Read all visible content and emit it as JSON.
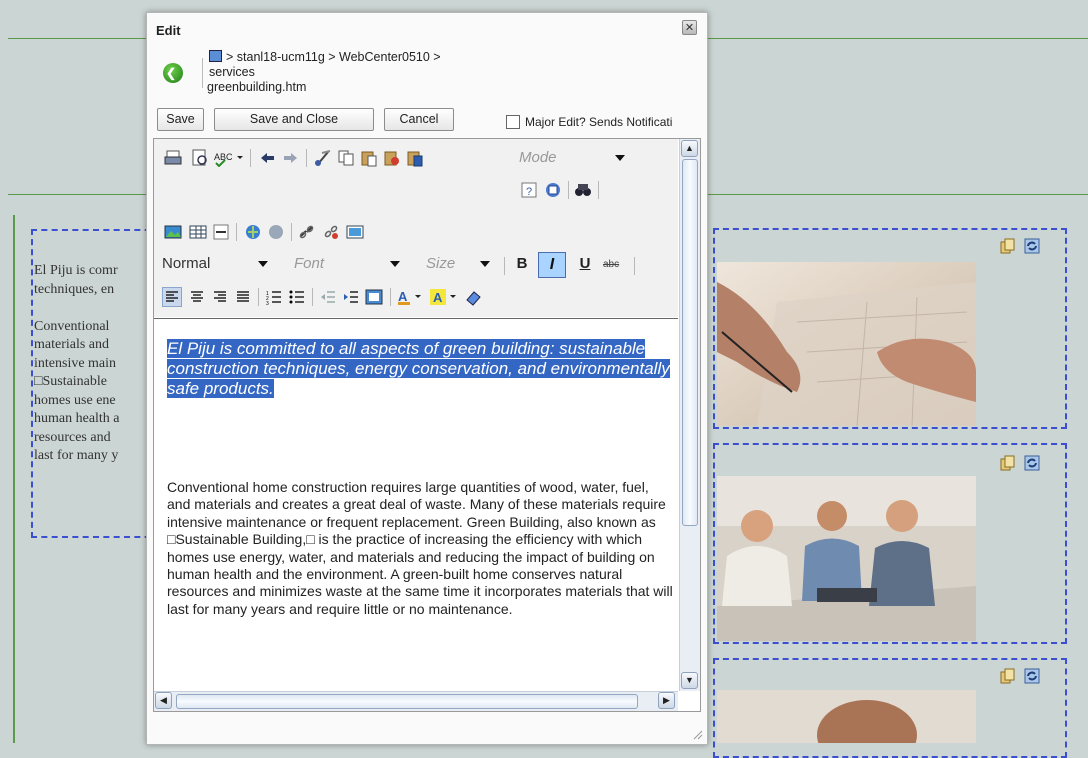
{
  "background": {
    "visible_lines": [
      "El Piju is comr",
      "techniques, en",
      "",
      "Conventional ",
      "materials and ",
      "intensive main",
      "□Sustainable",
      "homes use ene",
      "human health a",
      "resources and",
      "last for many y"
    ]
  },
  "dialog": {
    "title": "Edit",
    "close_icon": "close-x-icon",
    "back_icon": "back-arrow-icon",
    "breadcrumb_line1": "> stanl18-ucm11g > WebCenter0510 >",
    "breadcrumb_line2": "services",
    "filename": "greenbuilding.htm",
    "buttons": {
      "save": "Save",
      "save_close": "Save and Close",
      "cancel": "Cancel"
    },
    "major_edit_label": "Major Edit? Sends Notificati"
  },
  "toolbar": {
    "format_select": "Normal",
    "font_select": "Font",
    "size_select": "Size",
    "mode_select": "Mode",
    "bold": "B",
    "italic": "I",
    "underline": "U",
    "strike": "abc"
  },
  "editor": {
    "highlight_text": "El Piju is committed to all aspects of green building: sustainable construction techniques, energy conservation, and environmentally safe products.",
    "paragraph": "Conventional home construction requires large quantities of wood, water, fuel, and materials and creates a great deal of waste. Many of these materials require intensive maintenance or frequent replacement. Green Building, also known as □Sustainable Building,□ is the practice of increasing the efficiency with which homes use energy, water, and materials and reducing the impact of building on human health and the environment. A green-built home conserves natural resources and minimizes waste at the same time it incorporates materials that will last for many years and require little or no maintenance."
  },
  "colors": {
    "selection": "#3466c4",
    "dashed_border": "#3b4fd0",
    "page_bg": "#cbd5d3",
    "rule": "#5a9a4a"
  }
}
